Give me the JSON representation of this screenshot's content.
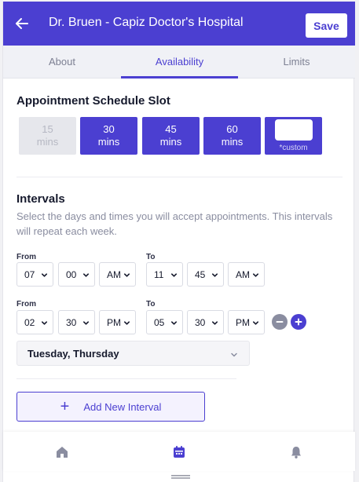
{
  "header": {
    "title": "Dr. Bruen - Capiz Doctor's Hospital",
    "save_label": "Save",
    "back_icon": "arrow-left-icon"
  },
  "tabs": [
    {
      "label": "About",
      "active": false
    },
    {
      "label": "Availability",
      "active": true
    },
    {
      "label": "Limits",
      "active": false
    }
  ],
  "schedule": {
    "heading": "Appointment Schedule Slot",
    "slots": [
      {
        "num": "15",
        "unit": "mins",
        "state": "disabled"
      },
      {
        "num": "30",
        "unit": "mins",
        "state": "enabled"
      },
      {
        "num": "45",
        "unit": "mins",
        "state": "enabled"
      },
      {
        "num": "60",
        "unit": "mins",
        "state": "enabled"
      }
    ],
    "custom": {
      "value": "",
      "label": "*custom"
    }
  },
  "intervals": {
    "heading": "Intervals",
    "description": "Select the days and times you will accept appointments. This intervals will repeat each week.",
    "from_label": "From",
    "to_label": "To",
    "rows": [
      {
        "from": {
          "hour": "07",
          "minute": "00",
          "period": "AM"
        },
        "to": {
          "hour": "11",
          "minute": "45",
          "period": "AM"
        }
      },
      {
        "from": {
          "hour": "02",
          "minute": "30",
          "period": "PM"
        },
        "to": {
          "hour": "05",
          "minute": "30",
          "period": "PM"
        }
      }
    ],
    "days": "Tuesday, Thursday",
    "add_label": "Add New Interval"
  },
  "bottom_nav": [
    "home-icon",
    "calendar-icon",
    "bell-icon"
  ],
  "colors": {
    "primary": "#4b3fd1",
    "disabled": "#e6e7ec",
    "muted_text": "#8a8da0"
  }
}
